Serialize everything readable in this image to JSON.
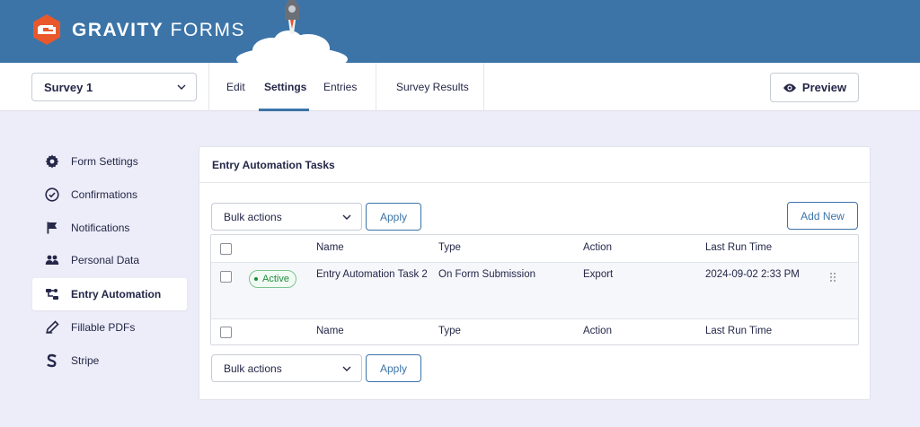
{
  "header": {
    "brand_bold": "GRAVITY",
    "brand_light": "FORMS",
    "colors": {
      "header_bg": "#3c74a8",
      "logo": "#e8582b",
      "accent": "#3c74a8"
    }
  },
  "toolbar": {
    "form_selector": {
      "value": "Survey 1"
    },
    "tabs": [
      {
        "label": "Edit"
      },
      {
        "label": "Settings"
      },
      {
        "label": "Entries"
      },
      {
        "label": "Survey Results"
      }
    ],
    "active_tab": "Settings",
    "preview_label": "Preview"
  },
  "sidebar": {
    "items": [
      {
        "label": "Form Settings",
        "icon": "gear-icon"
      },
      {
        "label": "Confirmations",
        "icon": "check-circle-icon"
      },
      {
        "label": "Notifications",
        "icon": "flag-icon"
      },
      {
        "label": "Personal Data",
        "icon": "people-icon"
      },
      {
        "label": "Entry Automation",
        "icon": "automation-icon"
      },
      {
        "label": "Fillable PDFs",
        "icon": "pen-icon"
      },
      {
        "label": "Stripe",
        "icon": "stripe-icon"
      }
    ],
    "active_item": "Entry Automation"
  },
  "panel": {
    "title": "Entry Automation Tasks",
    "bulk_actions_label": "Bulk actions",
    "apply_label": "Apply",
    "add_new_label": "Add New",
    "columns": {
      "name": "Name",
      "type": "Type",
      "action": "Action",
      "last_run": "Last Run Time"
    },
    "rows": [
      {
        "status": "Active",
        "name": "Entry Automation Task 2",
        "type": "On Form Submission",
        "action": "Export",
        "last_run": "2024-09-02 2:33 PM"
      }
    ]
  }
}
